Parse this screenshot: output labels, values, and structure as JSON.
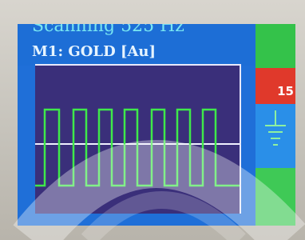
{
  "header": {
    "scan_text": "Scanning 525 Hz",
    "mode_text": "M1:  GOLD [Au]"
  },
  "sidebar": {
    "level_value": "15"
  },
  "colors": {
    "screen_bg": "#1f6fd8",
    "plot_bg": "#3a2f7a",
    "wave": "#3fe84a",
    "level_red": "#e0392b",
    "level_green": "#34c24a"
  },
  "icons": {
    "ground": "ground-symbol-icon"
  }
}
